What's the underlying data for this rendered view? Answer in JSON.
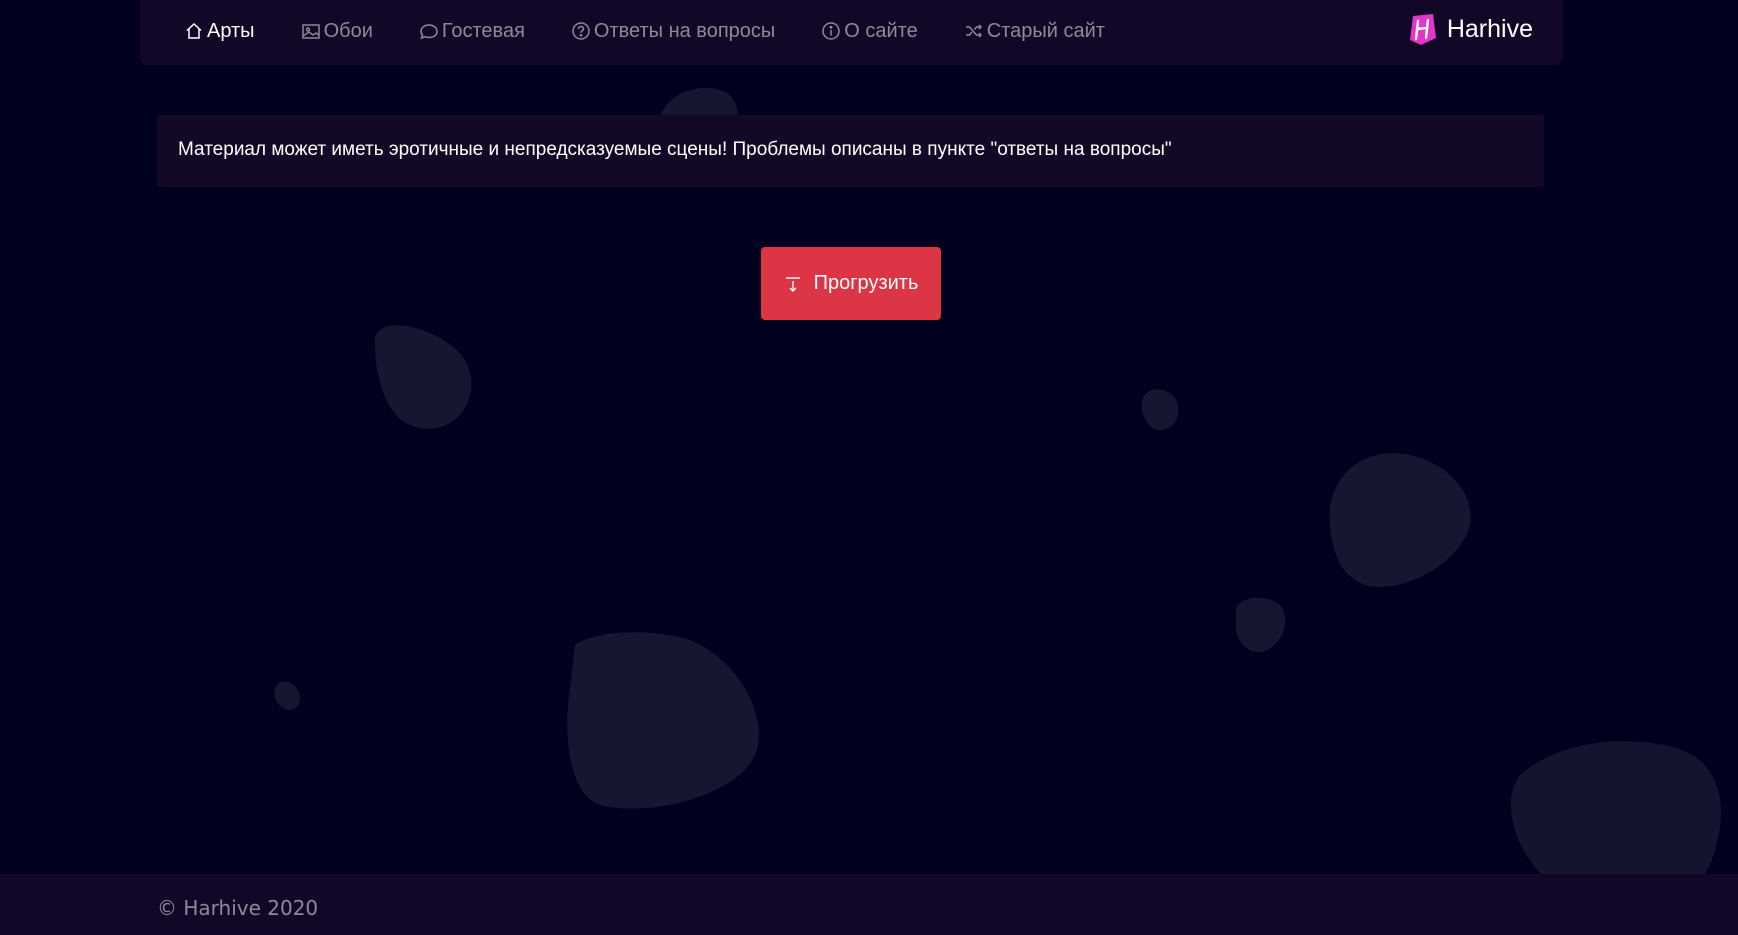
{
  "nav": {
    "items": [
      {
        "label": "Арты",
        "icon": "home-icon",
        "active": true
      },
      {
        "label": "Обои",
        "icon": "image-icon",
        "active": false
      },
      {
        "label": "Гостевая",
        "icon": "chat-bubble-icon",
        "active": false
      },
      {
        "label": "Ответы на вопросы",
        "icon": "question-circle-icon",
        "active": false
      },
      {
        "label": "О сайте",
        "icon": "info-circle-icon",
        "active": false
      },
      {
        "label": "Старый сайт",
        "icon": "shuffle-icon",
        "active": false
      }
    ],
    "brand": {
      "name": "Harhive",
      "logo_letter": "H"
    }
  },
  "notice": {
    "text": "Материал может иметь эротичные и непредсказуемые сцены! Проблемы описаны в пункте \"ответы на вопросы\""
  },
  "load_button": {
    "label": "Прогрузить",
    "icon": "download-arrow-icon"
  },
  "footer": {
    "copyright": "© Harhive 2020"
  },
  "colors": {
    "background": "#01001f",
    "panel": "#130727",
    "accent": "#dc3545",
    "text_muted": "#8d8a96",
    "text": "#ffffff",
    "blob": "#151630",
    "logo": "#e236c8"
  }
}
